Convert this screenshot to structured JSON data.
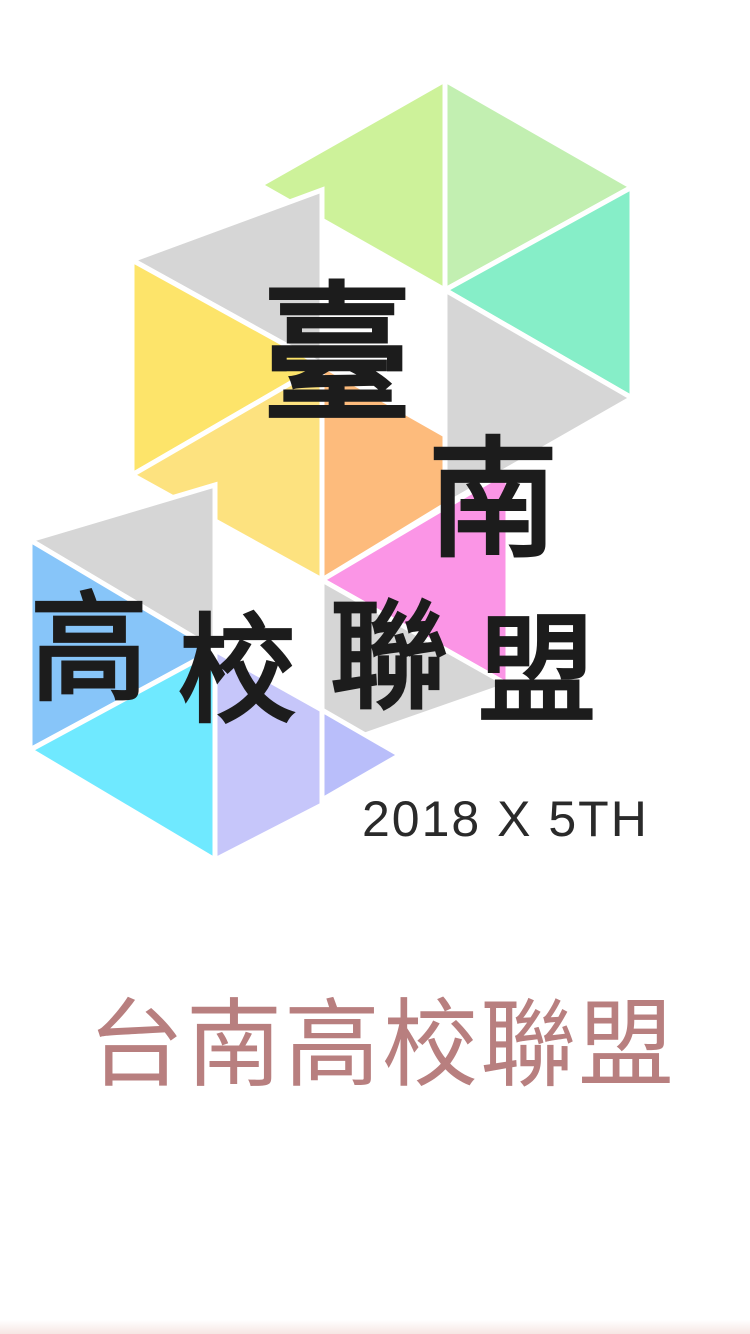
{
  "logo": {
    "title_char_1": "臺",
    "title_char_2": "南",
    "row_chars": [
      "高",
      "校",
      "聯",
      "盟"
    ],
    "edition": "2018 X 5TH",
    "tile_colors": {
      "lime": "#cdf29a",
      "light_green": "#c2efb1",
      "mint": "#86eec8",
      "gray": "#d6d6d6",
      "yellow": "#fde46a",
      "light_yellow": "#fde27f",
      "orange": "#fdbb7c",
      "magenta": "#fb95e6",
      "blue": "#87c5f9",
      "cyan": "#6fe9ff",
      "lavender": "#c6c6fa",
      "periwinkle": "#b9befa"
    }
  },
  "app_name": "台南高校聯盟",
  "colors": {
    "app_name": "#b87f7f",
    "background": "#ffffff"
  }
}
